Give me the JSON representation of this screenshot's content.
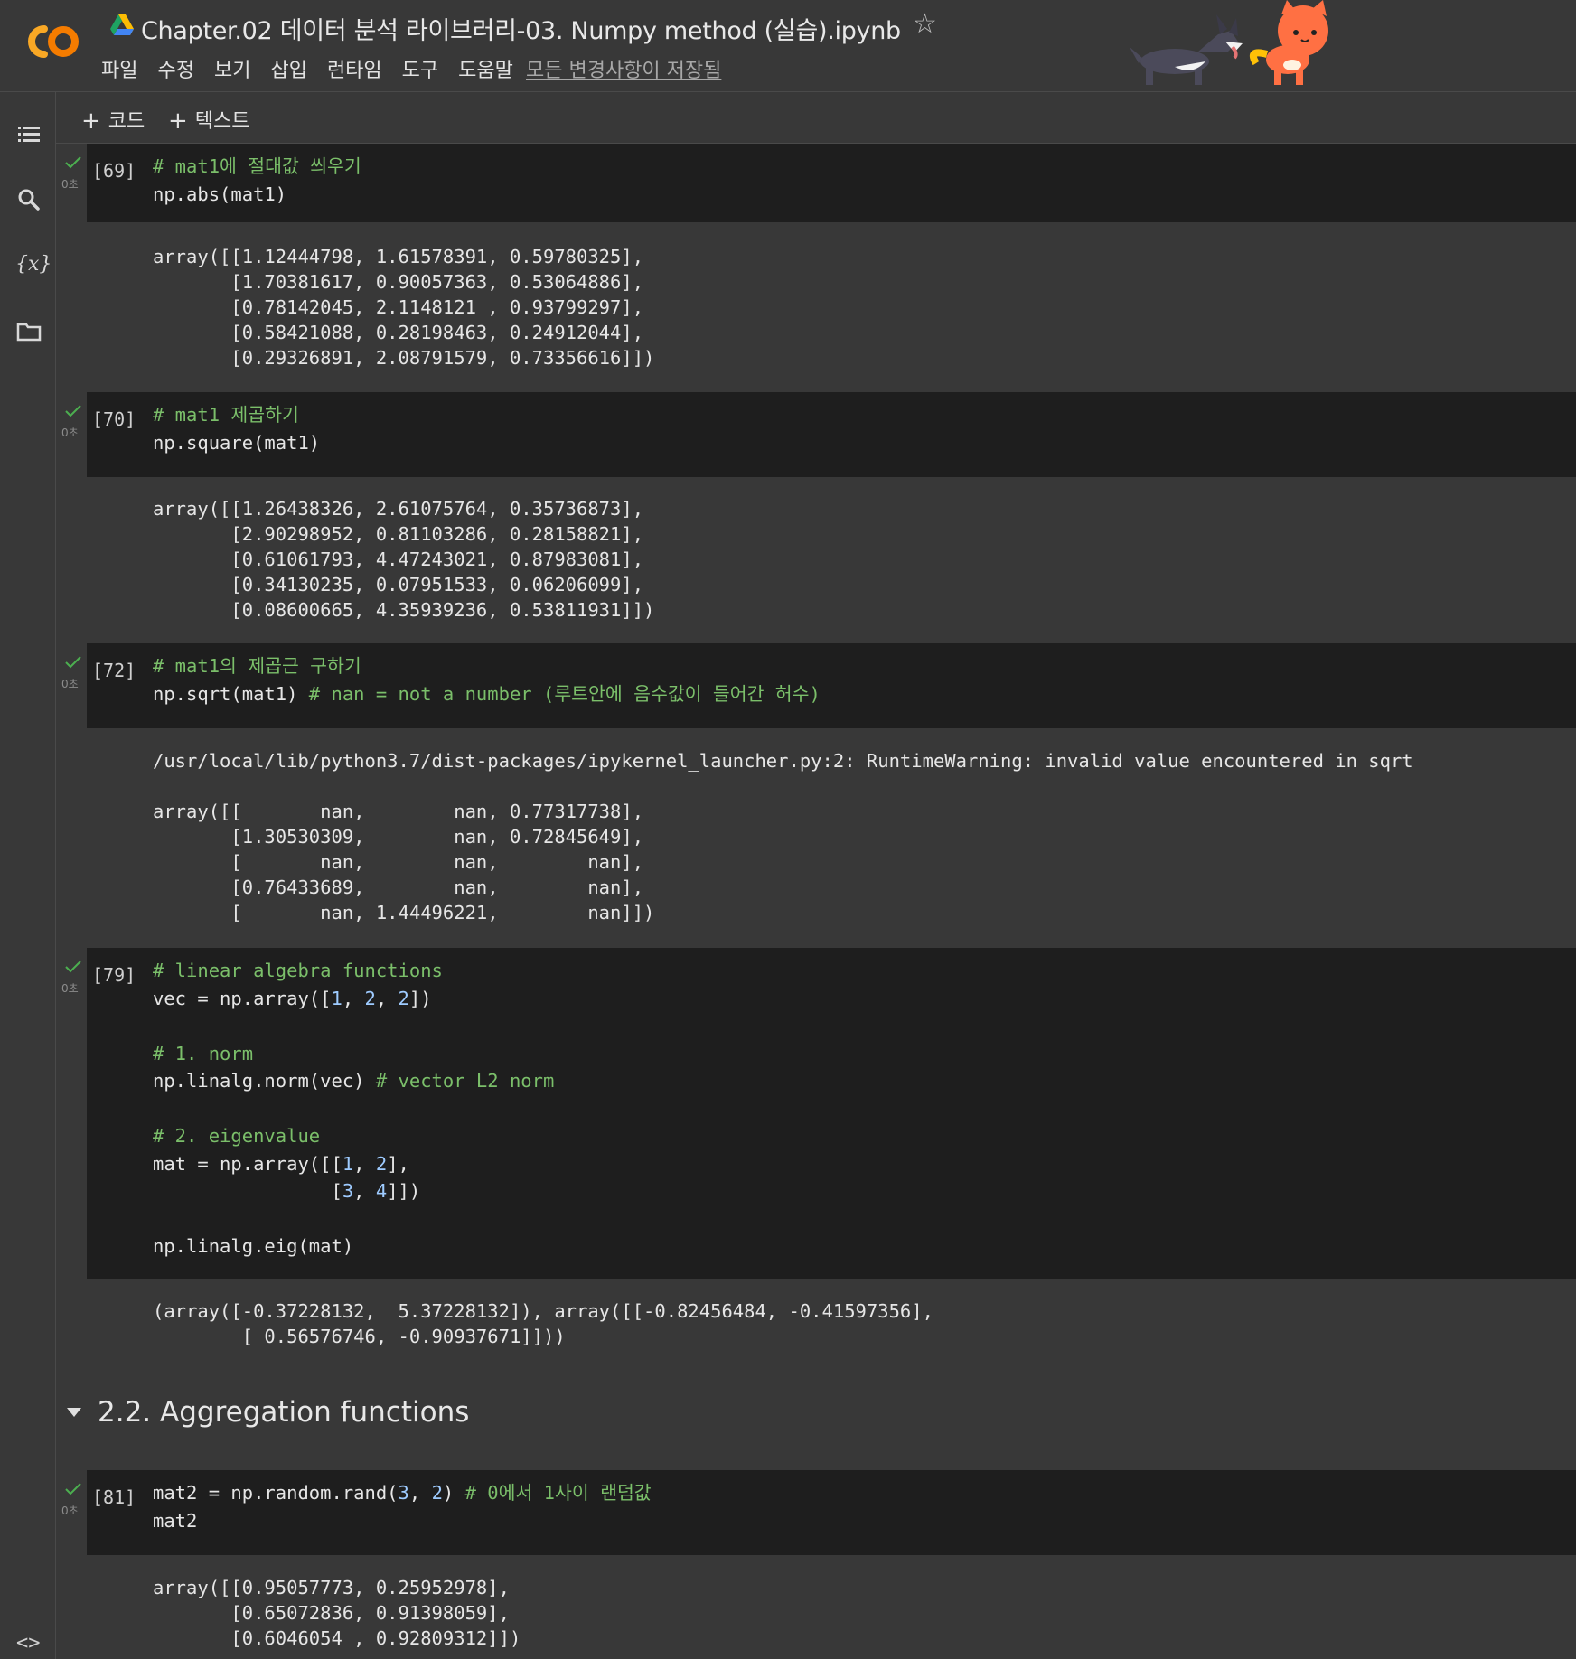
{
  "app": {
    "logo_text": "CO",
    "title": "Chapter.02 데이터 분석 라이브러리-03. Numpy method (실습).ipynb",
    "saved_status": "모든 변경사항이 저장됨"
  },
  "menu": [
    "파일",
    "수정",
    "보기",
    "삽입",
    "런타임",
    "도구",
    "도움말"
  ],
  "toolbar": {
    "add_code": "코드",
    "add_text": "텍스트"
  },
  "sidebar_icons": [
    "toc-icon",
    "search-icon",
    "variables-icon",
    "folder-icon"
  ],
  "cells": [
    {
      "exec": "[69]",
      "time": "0초",
      "code": [
        [
          {
            "t": "# mat1에 절대값 씌우기",
            "c": "comment"
          }
        ],
        [
          {
            "t": "np.abs(mat1)",
            "c": "plain"
          }
        ]
      ],
      "output": [
        "array([[1.12444798, 1.61578391, 0.59780325],",
        "       [1.70381617, 0.90057363, 0.53064886],",
        "       [0.78142045, 2.1148121 , 0.93799297],",
        "       [0.58421088, 0.28198463, 0.24912044],",
        "       [0.29326891, 2.08791579, 0.73356616]])"
      ]
    },
    {
      "exec": "[70]",
      "time": "0초",
      "code": [
        [
          {
            "t": "# mat1 제곱하기",
            "c": "comment"
          }
        ],
        [
          {
            "t": "np.square(mat1)",
            "c": "plain"
          }
        ]
      ],
      "output": [
        "array([[1.26438326, 2.61075764, 0.35736873],",
        "       [2.90298952, 0.81103286, 0.28158821],",
        "       [0.61061793, 4.47243021, 0.87983081],",
        "       [0.34130235, 0.07951533, 0.06206099],",
        "       [0.08600665, 4.35939236, 0.53811931]])"
      ]
    },
    {
      "exec": "[72]",
      "time": "0초",
      "code": [
        [
          {
            "t": "# mat1의 제곱근 구하기",
            "c": "comment"
          }
        ],
        [
          {
            "t": "np.sqrt(mat1) ",
            "c": "plain"
          },
          {
            "t": "# nan = not a number (루트안에 음수값이 들어간 허수)",
            "c": "comment"
          }
        ]
      ],
      "output": [
        "/usr/local/lib/python3.7/dist-packages/ipykernel_launcher.py:2: RuntimeWarning: invalid value encountered in sqrt",
        "",
        "array([[       nan,        nan, 0.77317738],",
        "       [1.30530309,        nan, 0.72845649],",
        "       [       nan,        nan,        nan],",
        "       [0.76433689,        nan,        nan],",
        "       [       nan, 1.44496221,        nan]])"
      ]
    },
    {
      "exec": "[79]",
      "time": "0초",
      "code": [
        [
          {
            "t": "# linear algebra functions",
            "c": "comment"
          }
        ],
        [
          {
            "t": "vec = np.array([",
            "c": "plain"
          },
          {
            "t": "1",
            "c": "num"
          },
          {
            "t": ", ",
            "c": "plain"
          },
          {
            "t": "2",
            "c": "num"
          },
          {
            "t": ", ",
            "c": "plain"
          },
          {
            "t": "2",
            "c": "num"
          },
          {
            "t": "])",
            "c": "plain"
          }
        ],
        [],
        [
          {
            "t": "# 1. norm",
            "c": "comment"
          }
        ],
        [
          {
            "t": "np.linalg.norm(vec) ",
            "c": "plain"
          },
          {
            "t": "# vector L2 norm",
            "c": "comment"
          }
        ],
        [],
        [
          {
            "t": "# 2. eigenvalue",
            "c": "comment"
          }
        ],
        [
          {
            "t": "mat = np.array([[",
            "c": "plain"
          },
          {
            "t": "1",
            "c": "num"
          },
          {
            "t": ", ",
            "c": "plain"
          },
          {
            "t": "2",
            "c": "num"
          },
          {
            "t": "],",
            "c": "plain"
          }
        ],
        [
          {
            "t": "                [",
            "c": "plain"
          },
          {
            "t": "3",
            "c": "num"
          },
          {
            "t": ", ",
            "c": "plain"
          },
          {
            "t": "4",
            "c": "num"
          },
          {
            "t": "]])",
            "c": "plain"
          }
        ],
        [],
        [
          {
            "t": "np.linalg.eig(mat)",
            "c": "plain"
          }
        ]
      ],
      "output": [
        "(array([-0.37228132,  5.37228132]), array([[-0.82456484, -0.41597356],",
        "        [ 0.56576746, -0.90937671]]))"
      ]
    },
    {
      "exec": "[81]",
      "time": "0초",
      "code": [
        [
          {
            "t": "mat2 = np.random.rand(",
            "c": "plain"
          },
          {
            "t": "3",
            "c": "num"
          },
          {
            "t": ", ",
            "c": "plain"
          },
          {
            "t": "2",
            "c": "num"
          },
          {
            "t": ") ",
            "c": "plain"
          },
          {
            "t": "# 0에서 1사이 랜덤값",
            "c": "comment"
          }
        ],
        [
          {
            "t": "mat2",
            "c": "plain"
          }
        ]
      ],
      "output": [
        "array([[0.95057773, 0.25952978],",
        "       [0.65072836, 0.91398059],",
        "       [0.6046054 , 0.92809312]])"
      ]
    }
  ],
  "section": {
    "title": "2.2. Aggregation functions"
  },
  "colors": {
    "bg": "#383838",
    "code_bg": "#1e1e1e",
    "comment": "#7bbf6a",
    "number": "#9ecbff",
    "check": "#4caf50",
    "logo": "#f9a825"
  }
}
